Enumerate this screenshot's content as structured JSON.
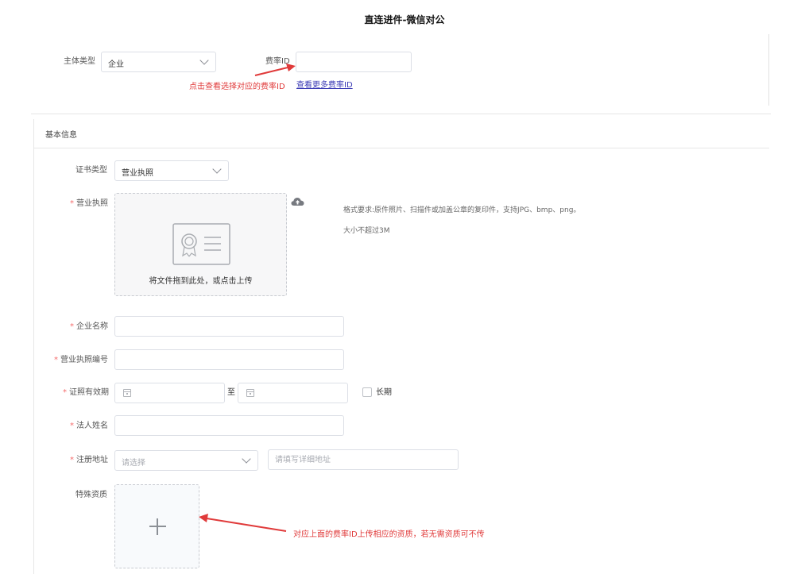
{
  "title": "直连进件-微信对公",
  "top": {
    "subject_type_label": "主体类型",
    "subject_type_value": "企业",
    "rate_id_label": "费率ID",
    "rate_id_value": "",
    "annotation": "点击查看选择对应的费率ID",
    "more_rates_link": "查看更多费率ID"
  },
  "basic": {
    "section_title": "基本信息",
    "cert_type_label": "证书类型",
    "cert_type_value": "营业执照",
    "license_label": "营业执照",
    "upload_hint": "将文件拖到此处，或点击上传",
    "format_note": "格式要求:原件照片、扫描件或加盖公章的复印件，支持JPG、bmp、png。",
    "size_note": "大小不超过3M",
    "company_name_label": "企业名称",
    "license_no_label": "营业执照编号",
    "validity_label": "证照有效期",
    "validity_sep": "至",
    "long_term_label": "长期",
    "legal_name_label": "法人姓名",
    "address_label": "注册地址",
    "address_select_placeholder": "请选择",
    "address_detail_placeholder": "请填写详细地址",
    "special_label": "特殊资质",
    "special_annotation": "对应上面的费率ID上传相应的资质，若无需资质可不传",
    "required_mark": "*"
  },
  "colors": {
    "annotation_red": "#e03a3a",
    "link_blue": "#3b3bb5",
    "border": "#dcdfe6"
  },
  "icons": [
    "chevron-down-icon",
    "certificate-icon",
    "cloud-upload-icon",
    "calendar-icon",
    "plus-icon",
    "arrow-annotation"
  ]
}
